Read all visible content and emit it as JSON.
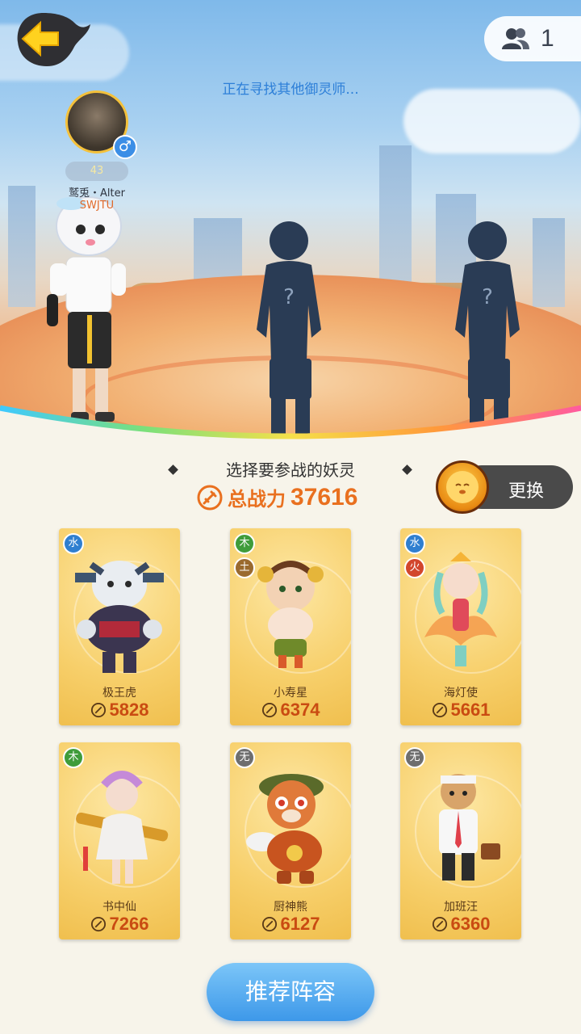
{
  "top": {
    "status_text": "正在寻找其他御灵师...",
    "party_count": "1"
  },
  "player": {
    "level": "43",
    "name": "鹫兎・Alter",
    "school": "SWJTU",
    "gender_symbol": "♂"
  },
  "unknown_mark": "?",
  "selection": {
    "title": "选择要参战的妖灵",
    "total_label": "总战力",
    "total_value": "37616",
    "change_label": "更换"
  },
  "cards": [
    {
      "name": "极王虎",
      "power": "5828",
      "elements": [
        "水"
      ]
    },
    {
      "name": "小寿星",
      "power": "6374",
      "elements": [
        "木",
        "土"
      ]
    },
    {
      "name": "海灯使",
      "power": "5661",
      "elements": [
        "水",
        "火"
      ]
    },
    {
      "name": "书中仙",
      "power": "7266",
      "elements": [
        "木"
      ]
    },
    {
      "name": "厨神熊",
      "power": "6127",
      "elements": [
        "无"
      ]
    },
    {
      "name": "加班汪",
      "power": "6360",
      "elements": [
        "无"
      ]
    }
  ],
  "recommend_label": "推荐阵容",
  "colors": {
    "accent_orange": "#e9701f",
    "button_blue": "#3d98e9",
    "status_blue": "#2d7fd8",
    "card_gold": "#f7cf6a"
  }
}
